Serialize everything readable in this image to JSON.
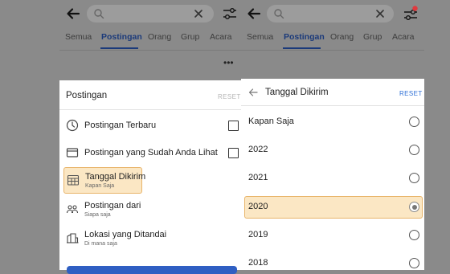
{
  "left_screen": {
    "tabs": [
      {
        "label": "Semua",
        "active": false
      },
      {
        "label": "Postingan",
        "active": true
      },
      {
        "label": "Orang",
        "active": false
      },
      {
        "label": "Grup",
        "active": false
      },
      {
        "label": "Acara",
        "active": false
      }
    ],
    "more_label": "•••",
    "sheet": {
      "title": "Postingan",
      "reset_label": "RESET",
      "options": [
        {
          "label": "Postingan Terbaru",
          "sub": "",
          "icon": "clock-icon"
        },
        {
          "label": "Postingan yang Sudah Anda Lihat",
          "sub": "",
          "icon": "browser-window-icon"
        },
        {
          "label": "Tanggal Dikirim",
          "sub": "Kapan Saja",
          "icon": "calendar-icon"
        },
        {
          "label": "Postingan dari",
          "sub": "Siapa saja",
          "icon": "people-icon"
        },
        {
          "label": "Lokasi yang Ditandai",
          "sub": "Di mana saja",
          "icon": "building-icon"
        }
      ]
    }
  },
  "right_screen": {
    "tabs": [
      {
        "label": "Semua",
        "active": false
      },
      {
        "label": "Postingan",
        "active": true
      },
      {
        "label": "Orang",
        "active": false
      },
      {
        "label": "Grup",
        "active": false
      },
      {
        "label": "Acara",
        "active": false
      }
    ],
    "filter_badge_color": "#e0393e",
    "sheet": {
      "title": "Tanggal Dikirim",
      "reset_label": "RESET",
      "options": [
        {
          "label": "Kapan Saja",
          "selected": false
        },
        {
          "label": "2022",
          "selected": false
        },
        {
          "label": "2021",
          "selected": false
        },
        {
          "label": "2020",
          "selected": true
        },
        {
          "label": "2019",
          "selected": false
        },
        {
          "label": "2018",
          "selected": false
        }
      ]
    }
  },
  "colors": {
    "overlay": "#8a8a8a",
    "accent": "#1b3a7a",
    "highlight_fill": "#fbe7c4",
    "highlight_border": "#e8b46a",
    "button_blue": "#2f5fc3",
    "reset_inactive": "#b5b5b5",
    "reset_active": "#2d6fd6"
  }
}
